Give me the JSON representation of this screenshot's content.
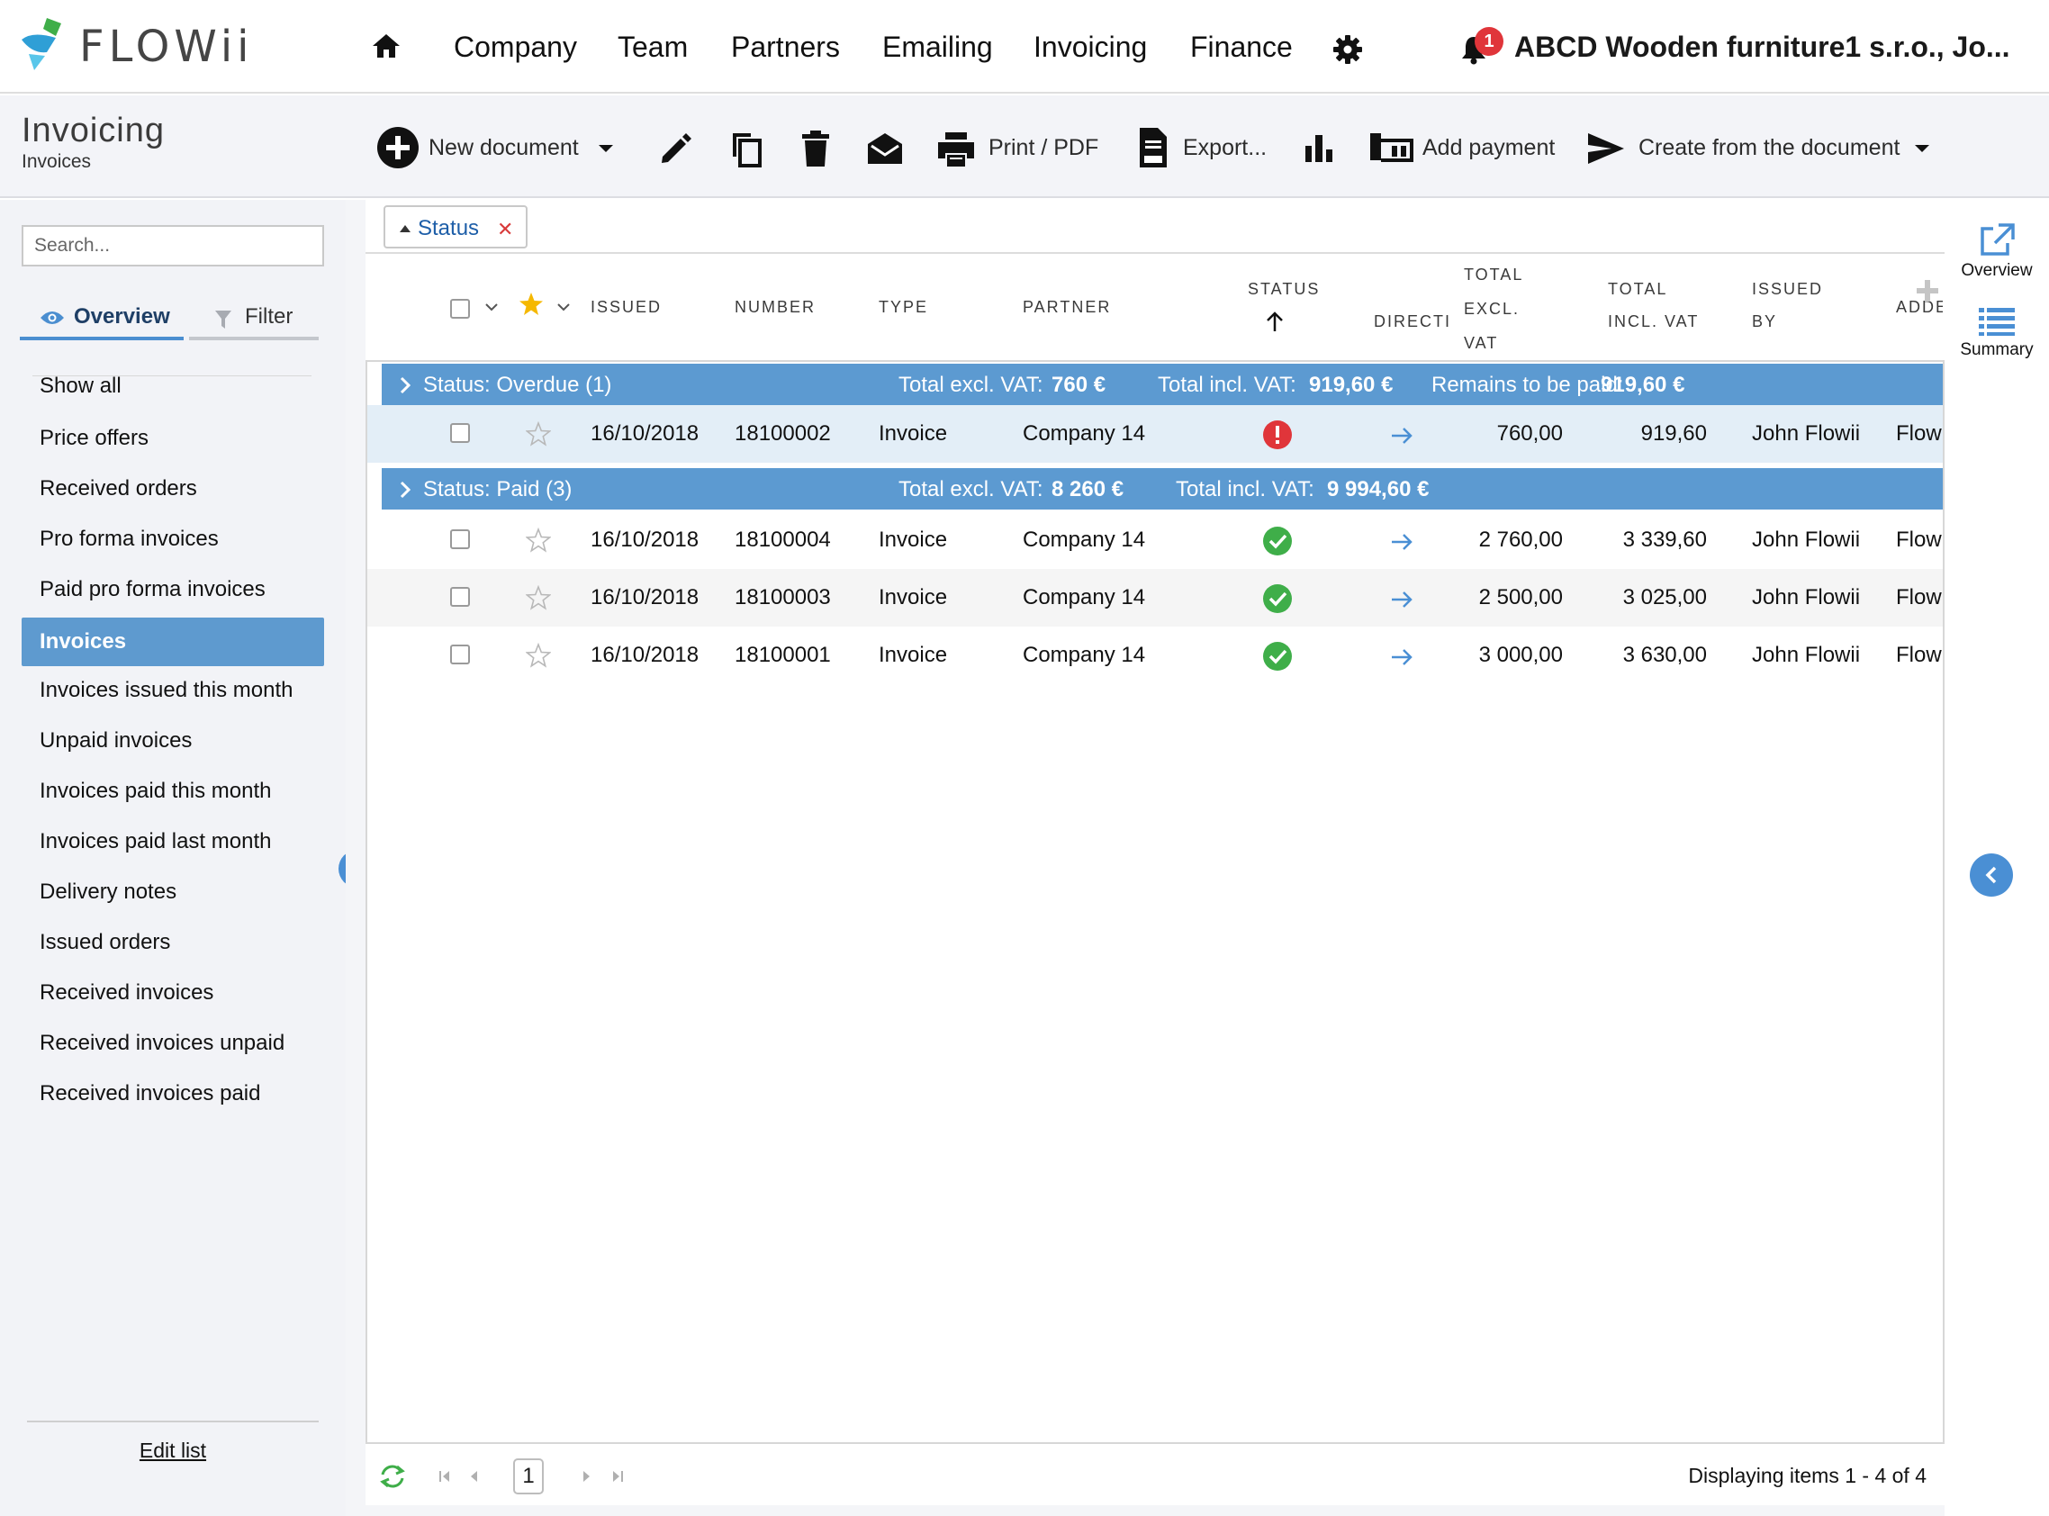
{
  "app": {
    "logo_text": "FLOWii"
  },
  "nav": {
    "items": [
      "Company",
      "Team",
      "Partners",
      "Emailing",
      "Invoicing",
      "Finance"
    ],
    "notifications_count": "1",
    "company": "ABCD Wooden furniture1 s.r.o., Jo..."
  },
  "toolbar": {
    "module_title": "Invoicing",
    "module_subtitle": "Invoices",
    "new_document": "New document",
    "print_pdf": "Print / PDF",
    "export": "Export...",
    "add_payment": "Add payment",
    "create_from": "Create from the document"
  },
  "sidebar": {
    "search_placeholder": "Search...",
    "tab_overview": "Overview",
    "tab_filter": "Filter",
    "items": [
      "Show all",
      "Price offers",
      "Received orders",
      "Pro forma invoices",
      "Paid pro forma invoices",
      "Invoices",
      "Invoices issued this month",
      "Unpaid invoices",
      "Invoices paid this month",
      "Invoices paid last month",
      "Delivery notes",
      "Issued orders",
      "Received invoices",
      "Received invoices unpaid",
      "Received invoices paid"
    ],
    "active_item": "Invoices",
    "edit_list": "Edit list"
  },
  "grid": {
    "group_chip": "Status",
    "columns": {
      "issued": "ISSUED",
      "number": "NUMBER",
      "type": "TYPE",
      "partner": "PARTNER",
      "status": "STATUS",
      "direction": "DIRECTIC",
      "total_excl_1": "TOTAL",
      "total_excl_2": "EXCL.",
      "total_excl_3": "VAT",
      "total_incl_1": "TOTAL",
      "total_incl_2": "INCL. VAT",
      "issued_by_1": "ISSUED",
      "issued_by_2": "BY",
      "added": "ADDE"
    },
    "groups": [
      {
        "title": "Status: Overdue (1)",
        "excl_label": "Total excl. VAT:",
        "excl_value": "760 €",
        "incl_label": "Total incl. VAT:",
        "incl_value": "919,60 €",
        "remains_label": "Remains to be paid:",
        "remains_value": "919,60 €",
        "rows": [
          {
            "issued": "16/10/2018",
            "number": "18100002",
            "type": "Invoice",
            "partner": "Company 14",
            "status": "overdue-icon",
            "total_excl": "760,00",
            "total_incl": "919,60",
            "issued_by": "John Flowii",
            "added": "Flow"
          }
        ]
      },
      {
        "title": "Status: Paid (3)",
        "excl_label": "Total excl. VAT:",
        "excl_value": "8 260 €",
        "incl_label": "Total incl. VAT:",
        "incl_value": "9 994,60 €",
        "rows": [
          {
            "issued": "16/10/2018",
            "number": "18100004",
            "type": "Invoice",
            "partner": "Company 14",
            "status": "paid-check-icon",
            "total_excl": "2 760,00",
            "total_incl": "3 339,60",
            "issued_by": "John Flowii",
            "added": "Flow"
          },
          {
            "issued": "16/10/2018",
            "number": "18100003",
            "type": "Invoice",
            "partner": "Company 14",
            "status": "paid-check-icon",
            "total_excl": "2 500,00",
            "total_incl": "3 025,00",
            "issued_by": "John Flowii",
            "added": "Flow"
          },
          {
            "issued": "16/10/2018",
            "number": "18100001",
            "type": "Invoice",
            "partner": "Company 14",
            "status": "paid-check-icon",
            "total_excl": "3 000,00",
            "total_incl": "3 630,00",
            "issued_by": "John Flowii",
            "added": "Flow"
          }
        ]
      }
    ],
    "pager": {
      "page": "1",
      "info": "Displaying items 1 - 4 of 4"
    }
  },
  "right_panel": {
    "overview": "Overview",
    "summary": "Summary"
  },
  "colors": {
    "accent": "#5c9ad1",
    "overdue": "#e0353a",
    "paid": "#3fae49",
    "star": "#f5b800"
  }
}
